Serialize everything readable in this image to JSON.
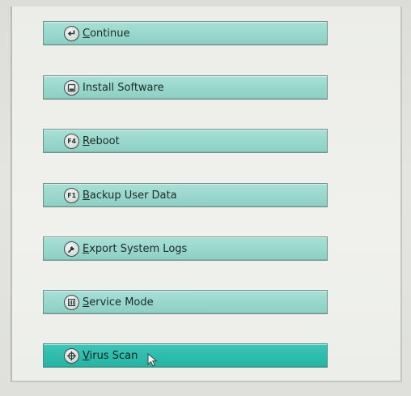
{
  "menu": {
    "items": [
      {
        "label_first": "C",
        "label_rest": "ontinue",
        "icon": "enter-arrow-icon"
      },
      {
        "label_first": "",
        "label_rest": "Install Software",
        "icon": "disk-icon"
      },
      {
        "label_first": "R",
        "label_rest": "eboot",
        "icon": "f4-key-icon",
        "key": "F4"
      },
      {
        "label_first": "B",
        "label_rest": "ackup User Data",
        "icon": "f1-key-icon",
        "key": "F1"
      },
      {
        "label_first": "E",
        "label_rest": "xport System Logs",
        "icon": "wrench-icon"
      },
      {
        "label_first": "S",
        "label_rest": "ervice Mode",
        "icon": "service-panel-icon"
      },
      {
        "label_first": "V",
        "label_rest": "irus Scan",
        "icon": "crosshair-icon"
      }
    ],
    "selected_index": 6
  },
  "colors": {
    "button_bg": "#98d7cb",
    "button_selected_bg": "#2ebcac",
    "panel_bg": "#eeefeb"
  }
}
